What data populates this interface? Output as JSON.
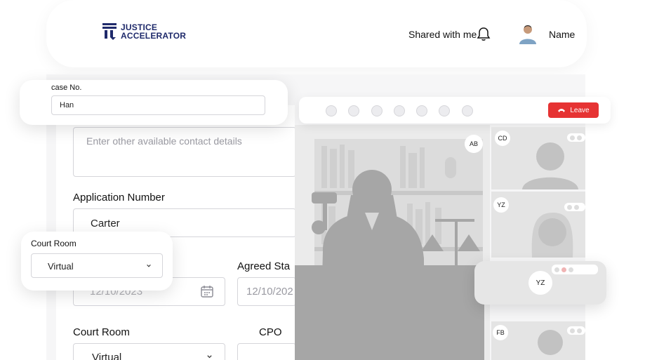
{
  "header": {
    "logo_line1": "JUSTICE",
    "logo_line2": "ACCELERATOR",
    "shared_with": "Shared with me",
    "user_name": "Name"
  },
  "case_card": {
    "label": "case No.",
    "value": "Han"
  },
  "form": {
    "contact_placeholder": "Enter other available contact details",
    "application_label": "Application Number",
    "application_value": "Carter",
    "date_value": "12/10/2023",
    "agreed_label": "Agreed Sta",
    "agreed_value": "12/10/202",
    "court_room_label": "Court Room",
    "court_room_value": "Virtual",
    "cpo_label": "CPO"
  },
  "court_card": {
    "label": "Court Room",
    "value": "Virtual"
  },
  "call": {
    "leave_label": "Leave",
    "participants": [
      "AB",
      "CD",
      "YZ",
      "YZ",
      "FB"
    ]
  },
  "colors": {
    "brand": "#1f2a6b",
    "leave": "#e63333"
  }
}
